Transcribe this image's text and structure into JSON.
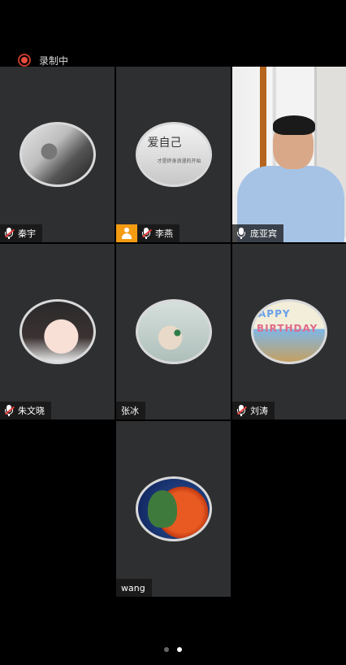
{
  "recording": {
    "label": "录制中",
    "color": "#e74c3c"
  },
  "participants": [
    {
      "name": "秦宇",
      "mic": "muted",
      "avatar": "old-man-photo"
    },
    {
      "name": "李燕",
      "mic": "muted",
      "host": true,
      "avatar": "text-graphic"
    },
    {
      "name": "庞亚宾",
      "mic": "on",
      "video": true,
      "active_speaker": true
    },
    {
      "name": "朱文晓",
      "mic": "muted",
      "avatar": "anime-girl"
    },
    {
      "name": "张冰",
      "mic": "none",
      "avatar": "hand-photo"
    },
    {
      "name": "刘涛",
      "mic": "muted",
      "avatar": "birthday-photo"
    },
    {
      "name": "wang",
      "mic": "none",
      "avatar": "moon-landscape"
    }
  ],
  "avatar_texts": {
    "text_graphic": {
      "big": "爱自己",
      "small": "才是终身浪漫的开始"
    },
    "birthday": {
      "line1": "APPY",
      "line2": "BIRTHDAY"
    }
  },
  "pager": {
    "pages": 2,
    "current": 2
  },
  "colors": {
    "tile_bg": "#2e2f31",
    "active_border": "#2ecc71",
    "host_badge": "#f39c12",
    "muted": "#e53935"
  }
}
